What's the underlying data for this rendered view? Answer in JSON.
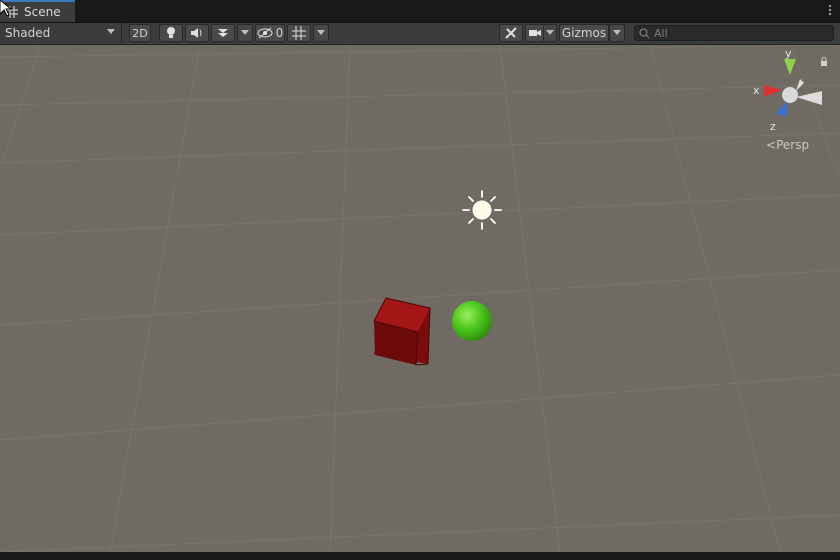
{
  "tab": {
    "label": "Scene",
    "icon": "scene-grid-icon"
  },
  "toolbar": {
    "draw_mode": "Shaded",
    "btn_2d": "2D",
    "hidden_count": "0",
    "gizmos": "Gizmos",
    "search_placeholder": "All",
    "icons": [
      "lighting-toggle-icon",
      "audio-toggle-icon",
      "effects-toggle-icon",
      "visibility-icon",
      "grid-icon",
      "tools-icon",
      "camera-icon"
    ]
  },
  "orientation_gizmo": {
    "axes": {
      "y": "y",
      "x": "x",
      "z": "z"
    },
    "mode": "Persp",
    "colors": {
      "x": "#e03131",
      "y": "#8fd14f",
      "z": "#3a6fd8"
    }
  },
  "scene": {
    "objects": [
      "directional-light-icon",
      "red-cube",
      "green-sphere"
    ],
    "colors": {
      "cube": "#8b0d0d",
      "sphere": "#4ec71e",
      "ground": "#6f6a62"
    }
  }
}
